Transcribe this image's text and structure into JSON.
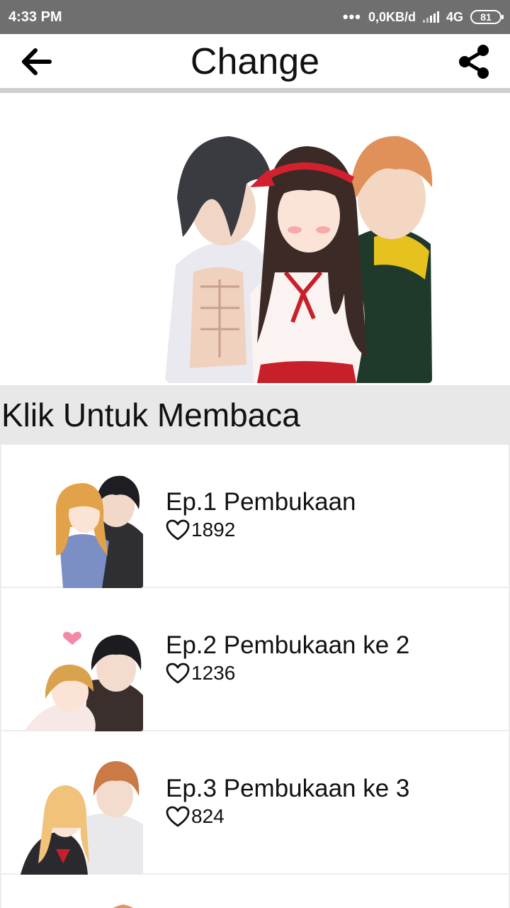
{
  "status_bar": {
    "time": "4:33 PM",
    "dots": "•••",
    "network_speed": "0,0KB/d",
    "network_type": "4G",
    "battery": "81"
  },
  "app_bar": {
    "title": "Change",
    "back_icon": "arrow-left-icon",
    "share_icon": "share-icon"
  },
  "section": {
    "title": "Klik Untuk Membaca"
  },
  "episodes": [
    {
      "title": "Ep.1 Pembukaan",
      "likes": "1892"
    },
    {
      "title": "Ep.2 Pembukaan ke 2",
      "likes": "1236"
    },
    {
      "title": "Ep.3 Pembukaan ke 3",
      "likes": "824"
    }
  ],
  "colors": {
    "status_bar": "#6f6f6f",
    "section_bg": "#e8e8e8",
    "divider": "#cfcfcf"
  }
}
